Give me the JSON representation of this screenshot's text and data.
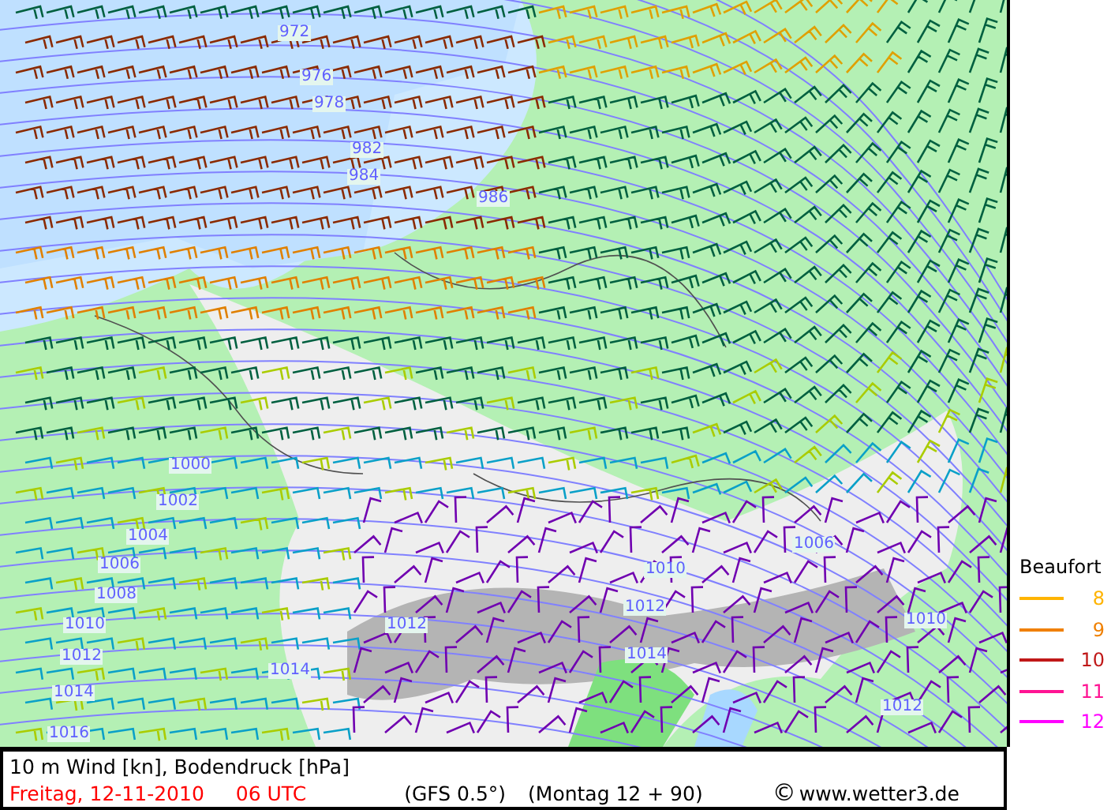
{
  "map": {
    "isobar_labels": [
      "972",
      "976",
      "978",
      "982",
      "984",
      "986",
      "1000",
      "1002",
      "1004",
      "1006",
      "1008",
      "1010",
      "1012",
      "1014",
      "1016",
      "1006",
      "1010",
      "1012",
      "1014",
      "1010",
      "1012",
      "1012",
      "1014"
    ]
  },
  "legend": {
    "title": "Beaufort",
    "items": [
      {
        "label": "8",
        "color": "#ffb400"
      },
      {
        "label": "9",
        "color": "#f08000"
      },
      {
        "label": "10",
        "color": "#c01818"
      },
      {
        "label": "11",
        "color": "#ff1493"
      },
      {
        "label": "12",
        "color": "#ff00ff"
      }
    ]
  },
  "footer": {
    "title": "10 m Wind [kn], Bodendruck [hPa]",
    "date": "Freitag, 12-11-2010",
    "time": "06 UTC",
    "model": "(GFS 0.5°)",
    "run": "(Montag 12 + 90)",
    "copyright_symbol": "©",
    "site": "www.wetter3.de"
  }
}
